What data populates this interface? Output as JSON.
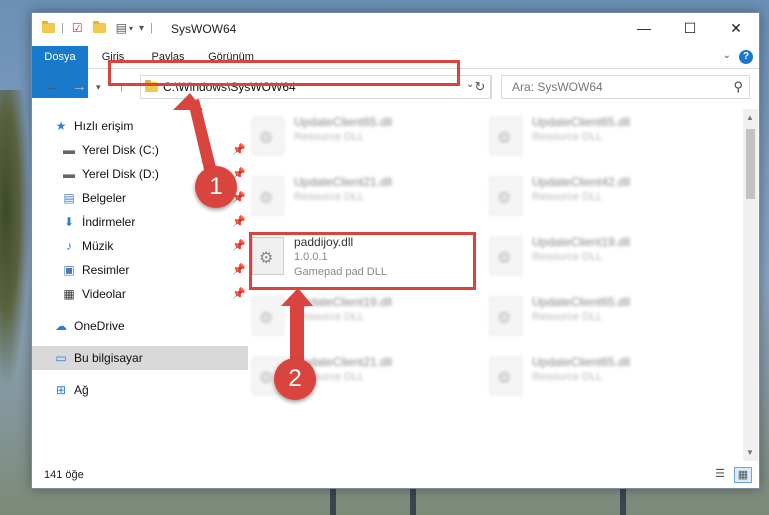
{
  "window": {
    "title": "SysWOW64",
    "controls": {
      "minimize": "—",
      "maximize": "☐",
      "close": "✕"
    }
  },
  "ribbon": {
    "tabs": [
      "Dosya",
      "Giriş",
      "Paylaş",
      "Görünüm"
    ],
    "help": "?"
  },
  "address": {
    "path": "C:\\Windows\\SysWOW64",
    "search_placeholder": "Ara: SysWOW64"
  },
  "sidebar": {
    "items": [
      {
        "label": "Hızlı erişim",
        "icon": "star-icon",
        "pinned": false
      },
      {
        "label": "Yerel Disk (C:)",
        "icon": "drive-icon",
        "pinned": true
      },
      {
        "label": "Yerel Disk (D:)",
        "icon": "drive-icon",
        "pinned": true
      },
      {
        "label": "Belgeler",
        "icon": "documents-icon",
        "pinned": true
      },
      {
        "label": "İndirmeler",
        "icon": "download-icon",
        "pinned": true
      },
      {
        "label": "Müzik",
        "icon": "music-icon",
        "pinned": true
      },
      {
        "label": "Resimler",
        "icon": "pictures-icon",
        "pinned": true
      },
      {
        "label": "Videolar",
        "icon": "video-icon",
        "pinned": true
      },
      {
        "label": "OneDrive",
        "icon": "cloud-icon",
        "pinned": false
      },
      {
        "label": "Bu bilgisayar",
        "icon": "computer-icon",
        "pinned": false
      },
      {
        "label": "Ağ",
        "icon": "network-icon",
        "pinned": false
      }
    ]
  },
  "files": {
    "left": [
      {
        "name": "UpdateClient65.dll",
        "desc": "Resource DLL"
      },
      {
        "name": "UpdateClient21.dll",
        "desc": "Resource DLL"
      },
      {
        "name": "paddijoy.dll",
        "version": "1.0.0.1",
        "desc": "Gamepad pad DLL"
      },
      {
        "name": "UpdateClient19.dll",
        "desc": "Resource DLL"
      },
      {
        "name": "UpdateClient21.dll",
        "desc": "Resource DLL"
      }
    ],
    "right": [
      {
        "name": "UpdateClient65.dll",
        "desc": "Resource DLL"
      },
      {
        "name": "UpdateClient42.dll",
        "desc": "Resource DLL"
      },
      {
        "name": "UpdateClient19.dll",
        "desc": "Resource DLL"
      },
      {
        "name": "UpdateClient65.dll",
        "desc": "Resource DLL"
      },
      {
        "name": "UpdateClient65.dll",
        "desc": "Resource DLL"
      }
    ]
  },
  "status": {
    "count": "141 öğe"
  },
  "annotations": {
    "step1": "1",
    "step2": "2"
  },
  "colors": {
    "accent": "#1979ca",
    "highlight": "#d9443f",
    "selection": "#d9d9d9"
  }
}
